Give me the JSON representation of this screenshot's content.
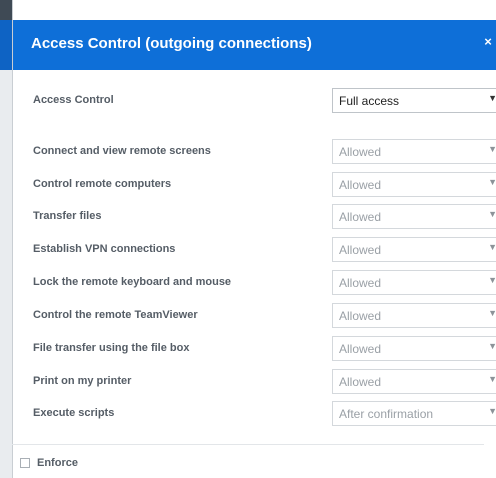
{
  "dialog": {
    "title": "Access Control (outgoing connections)",
    "close_glyph": "×"
  },
  "access_control": {
    "label": "Access Control",
    "value": "Full access"
  },
  "permissions": [
    {
      "label": "Connect and view remote screens",
      "value": "Allowed"
    },
    {
      "label": "Control remote computers",
      "value": "Allowed"
    },
    {
      "label": "Transfer files",
      "value": "Allowed"
    },
    {
      "label": "Establish VPN connections",
      "value": "Allowed"
    },
    {
      "label": "Lock the remote keyboard and mouse",
      "value": "Allowed"
    },
    {
      "label": "Control the remote TeamViewer",
      "value": "Allowed"
    },
    {
      "label": "File transfer using the file box",
      "value": "Allowed"
    },
    {
      "label": "Print on my printer",
      "value": "Allowed"
    },
    {
      "label": "Execute scripts",
      "value": "After confirmation"
    }
  ],
  "enforce": {
    "label": "Enforce",
    "checked": false
  },
  "icons": {
    "dropdown": "chevron-down-icon",
    "close": "close-icon",
    "checkbox": "checkbox-icon"
  },
  "colors": {
    "header": "#0e6fd8",
    "label_text": "#555d66",
    "disabled_text": "#9aa0a6"
  }
}
